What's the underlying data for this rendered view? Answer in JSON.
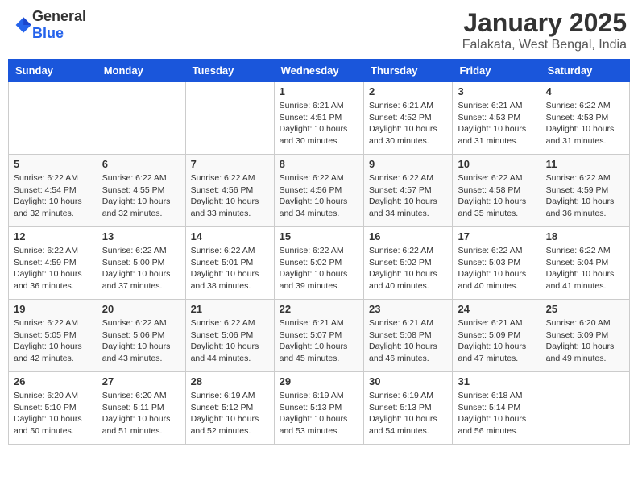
{
  "logo": {
    "text_general": "General",
    "text_blue": "Blue"
  },
  "title": "January 2025",
  "subtitle": "Falakata, West Bengal, India",
  "days_of_week": [
    "Sunday",
    "Monday",
    "Tuesday",
    "Wednesday",
    "Thursday",
    "Friday",
    "Saturday"
  ],
  "weeks": [
    [
      {
        "day": "",
        "sunrise": "",
        "sunset": "",
        "daylight": ""
      },
      {
        "day": "",
        "sunrise": "",
        "sunset": "",
        "daylight": ""
      },
      {
        "day": "",
        "sunrise": "",
        "sunset": "",
        "daylight": ""
      },
      {
        "day": "1",
        "sunrise": "Sunrise: 6:21 AM",
        "sunset": "Sunset: 4:51 PM",
        "daylight": "Daylight: 10 hours and 30 minutes."
      },
      {
        "day": "2",
        "sunrise": "Sunrise: 6:21 AM",
        "sunset": "Sunset: 4:52 PM",
        "daylight": "Daylight: 10 hours and 30 minutes."
      },
      {
        "day": "3",
        "sunrise": "Sunrise: 6:21 AM",
        "sunset": "Sunset: 4:53 PM",
        "daylight": "Daylight: 10 hours and 31 minutes."
      },
      {
        "day": "4",
        "sunrise": "Sunrise: 6:22 AM",
        "sunset": "Sunset: 4:53 PM",
        "daylight": "Daylight: 10 hours and 31 minutes."
      }
    ],
    [
      {
        "day": "5",
        "sunrise": "Sunrise: 6:22 AM",
        "sunset": "Sunset: 4:54 PM",
        "daylight": "Daylight: 10 hours and 32 minutes."
      },
      {
        "day": "6",
        "sunrise": "Sunrise: 6:22 AM",
        "sunset": "Sunset: 4:55 PM",
        "daylight": "Daylight: 10 hours and 32 minutes."
      },
      {
        "day": "7",
        "sunrise": "Sunrise: 6:22 AM",
        "sunset": "Sunset: 4:56 PM",
        "daylight": "Daylight: 10 hours and 33 minutes."
      },
      {
        "day": "8",
        "sunrise": "Sunrise: 6:22 AM",
        "sunset": "Sunset: 4:56 PM",
        "daylight": "Daylight: 10 hours and 34 minutes."
      },
      {
        "day": "9",
        "sunrise": "Sunrise: 6:22 AM",
        "sunset": "Sunset: 4:57 PM",
        "daylight": "Daylight: 10 hours and 34 minutes."
      },
      {
        "day": "10",
        "sunrise": "Sunrise: 6:22 AM",
        "sunset": "Sunset: 4:58 PM",
        "daylight": "Daylight: 10 hours and 35 minutes."
      },
      {
        "day": "11",
        "sunrise": "Sunrise: 6:22 AM",
        "sunset": "Sunset: 4:59 PM",
        "daylight": "Daylight: 10 hours and 36 minutes."
      }
    ],
    [
      {
        "day": "12",
        "sunrise": "Sunrise: 6:22 AM",
        "sunset": "Sunset: 4:59 PM",
        "daylight": "Daylight: 10 hours and 36 minutes."
      },
      {
        "day": "13",
        "sunrise": "Sunrise: 6:22 AM",
        "sunset": "Sunset: 5:00 PM",
        "daylight": "Daylight: 10 hours and 37 minutes."
      },
      {
        "day": "14",
        "sunrise": "Sunrise: 6:22 AM",
        "sunset": "Sunset: 5:01 PM",
        "daylight": "Daylight: 10 hours and 38 minutes."
      },
      {
        "day": "15",
        "sunrise": "Sunrise: 6:22 AM",
        "sunset": "Sunset: 5:02 PM",
        "daylight": "Daylight: 10 hours and 39 minutes."
      },
      {
        "day": "16",
        "sunrise": "Sunrise: 6:22 AM",
        "sunset": "Sunset: 5:02 PM",
        "daylight": "Daylight: 10 hours and 40 minutes."
      },
      {
        "day": "17",
        "sunrise": "Sunrise: 6:22 AM",
        "sunset": "Sunset: 5:03 PM",
        "daylight": "Daylight: 10 hours and 40 minutes."
      },
      {
        "day": "18",
        "sunrise": "Sunrise: 6:22 AM",
        "sunset": "Sunset: 5:04 PM",
        "daylight": "Daylight: 10 hours and 41 minutes."
      }
    ],
    [
      {
        "day": "19",
        "sunrise": "Sunrise: 6:22 AM",
        "sunset": "Sunset: 5:05 PM",
        "daylight": "Daylight: 10 hours and 42 minutes."
      },
      {
        "day": "20",
        "sunrise": "Sunrise: 6:22 AM",
        "sunset": "Sunset: 5:06 PM",
        "daylight": "Daylight: 10 hours and 43 minutes."
      },
      {
        "day": "21",
        "sunrise": "Sunrise: 6:22 AM",
        "sunset": "Sunset: 5:06 PM",
        "daylight": "Daylight: 10 hours and 44 minutes."
      },
      {
        "day": "22",
        "sunrise": "Sunrise: 6:21 AM",
        "sunset": "Sunset: 5:07 PM",
        "daylight": "Daylight: 10 hours and 45 minutes."
      },
      {
        "day": "23",
        "sunrise": "Sunrise: 6:21 AM",
        "sunset": "Sunset: 5:08 PM",
        "daylight": "Daylight: 10 hours and 46 minutes."
      },
      {
        "day": "24",
        "sunrise": "Sunrise: 6:21 AM",
        "sunset": "Sunset: 5:09 PM",
        "daylight": "Daylight: 10 hours and 47 minutes."
      },
      {
        "day": "25",
        "sunrise": "Sunrise: 6:20 AM",
        "sunset": "Sunset: 5:09 PM",
        "daylight": "Daylight: 10 hours and 49 minutes."
      }
    ],
    [
      {
        "day": "26",
        "sunrise": "Sunrise: 6:20 AM",
        "sunset": "Sunset: 5:10 PM",
        "daylight": "Daylight: 10 hours and 50 minutes."
      },
      {
        "day": "27",
        "sunrise": "Sunrise: 6:20 AM",
        "sunset": "Sunset: 5:11 PM",
        "daylight": "Daylight: 10 hours and 51 minutes."
      },
      {
        "day": "28",
        "sunrise": "Sunrise: 6:19 AM",
        "sunset": "Sunset: 5:12 PM",
        "daylight": "Daylight: 10 hours and 52 minutes."
      },
      {
        "day": "29",
        "sunrise": "Sunrise: 6:19 AM",
        "sunset": "Sunset: 5:13 PM",
        "daylight": "Daylight: 10 hours and 53 minutes."
      },
      {
        "day": "30",
        "sunrise": "Sunrise: 6:19 AM",
        "sunset": "Sunset: 5:13 PM",
        "daylight": "Daylight: 10 hours and 54 minutes."
      },
      {
        "day": "31",
        "sunrise": "Sunrise: 6:18 AM",
        "sunset": "Sunset: 5:14 PM",
        "daylight": "Daylight: 10 hours and 56 minutes."
      },
      {
        "day": "",
        "sunrise": "",
        "sunset": "",
        "daylight": ""
      }
    ]
  ]
}
